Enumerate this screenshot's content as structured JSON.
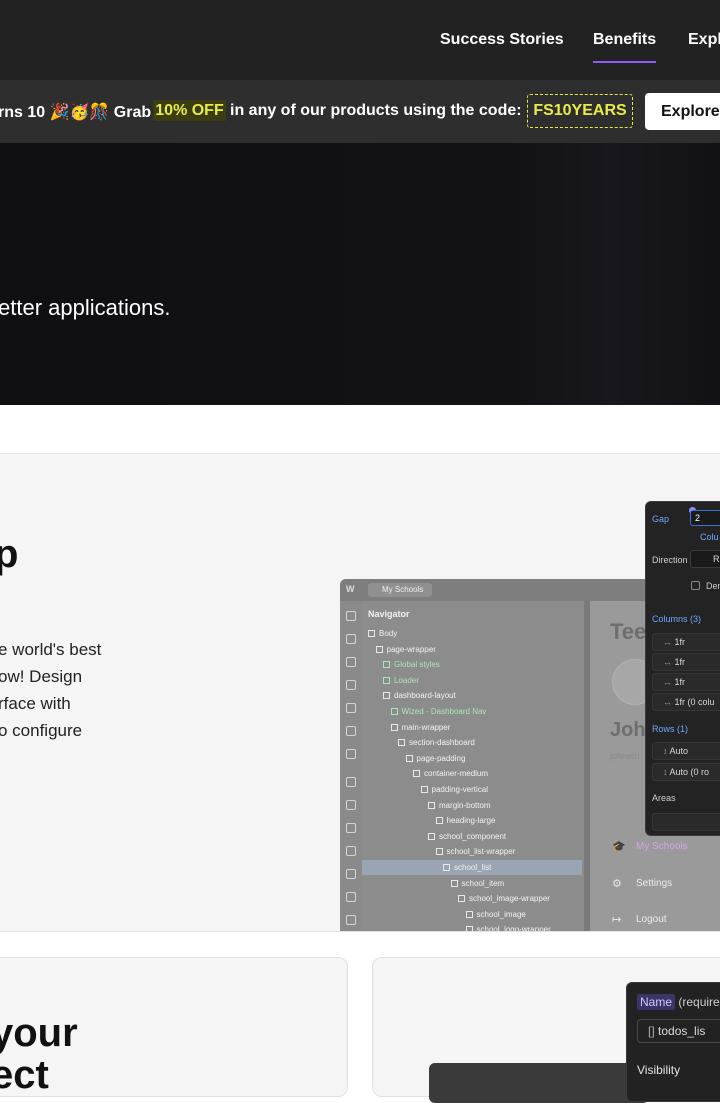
{
  "nav": {
    "links": [
      "Success Stories",
      "Benefits",
      "Expl"
    ],
    "active": "Benefits"
  },
  "promo": {
    "text_before": "rns 10 🎉🥳🎊 Grab",
    "highlight": "10% OFF",
    "text_after": "in any of our products using the code:",
    "code": "FS10YEARS",
    "button": "Explore"
  },
  "hero": {
    "subtitle": "etter applications."
  },
  "feature": {
    "heading": "p",
    "paragraph_lines": [
      "e world's best",
      "ow! Design",
      "rface with",
      "o configure"
    ]
  },
  "app_shot": {
    "tab_label": "My Schools",
    "logo": "W",
    "navigator_title": "Navigator",
    "tree": [
      {
        "label": "Body",
        "indent": 0,
        "green": false
      },
      {
        "label": "page-wrapper",
        "indent": 1,
        "green": false
      },
      {
        "label": "Global styles",
        "indent": 2,
        "green": true
      },
      {
        "label": "Loader",
        "indent": 2,
        "green": true
      },
      {
        "label": "dashboard-layout",
        "indent": 2,
        "green": false
      },
      {
        "label": "Wized - Dashboard Nav",
        "indent": 3,
        "green": true
      },
      {
        "label": "main-wrapper",
        "indent": 3,
        "green": false
      },
      {
        "label": "section-dashboard",
        "indent": 4,
        "green": false
      },
      {
        "label": "page-padding",
        "indent": 5,
        "green": false
      },
      {
        "label": "container-medium",
        "indent": 6,
        "green": false
      },
      {
        "label": "padding-vertical",
        "indent": 7,
        "green": false
      },
      {
        "label": "margin-bottom",
        "indent": 8,
        "green": false
      },
      {
        "label": "heading-large",
        "indent": 9,
        "green": false
      },
      {
        "label": "school_component",
        "indent": 8,
        "green": false
      },
      {
        "label": "school_list-wrapper",
        "indent": 9,
        "green": false
      },
      {
        "label": "school_list",
        "indent": 10,
        "green": false
      },
      {
        "label": "school_item",
        "indent": 11,
        "green": false
      },
      {
        "label": "school_image-wrapper",
        "indent": 12,
        "green": false
      },
      {
        "label": "school_image",
        "indent": 13,
        "green": false
      },
      {
        "label": "school_logo-wrapper",
        "indent": 13,
        "green": false
      }
    ],
    "canvas": {
      "heading": "Tee",
      "name": "Joh",
      "email": "johnem",
      "items": [
        "My Schools",
        "Settings",
        "Logout"
      ]
    }
  },
  "grid_panel": {
    "gap_label": "Gap",
    "gap_value": "2",
    "columns_link": "Colu",
    "direction_label": "Direction",
    "direction_value": "R",
    "dense_label": "Den",
    "columns_title": "Columns (3)",
    "columns": [
      "1fr",
      "1fr",
      "1fr",
      "1fr (0 colu"
    ],
    "rows_title": "Rows (1)",
    "rows": [
      "Auto",
      "Auto (0 ro"
    ],
    "areas_label": "Areas"
  },
  "cards": {
    "heading": "your\nect",
    "panel_name_tag": "Name",
    "panel_name_rest": "(require",
    "panel_input": "todos_lis",
    "panel_visibility": "Visibility"
  }
}
